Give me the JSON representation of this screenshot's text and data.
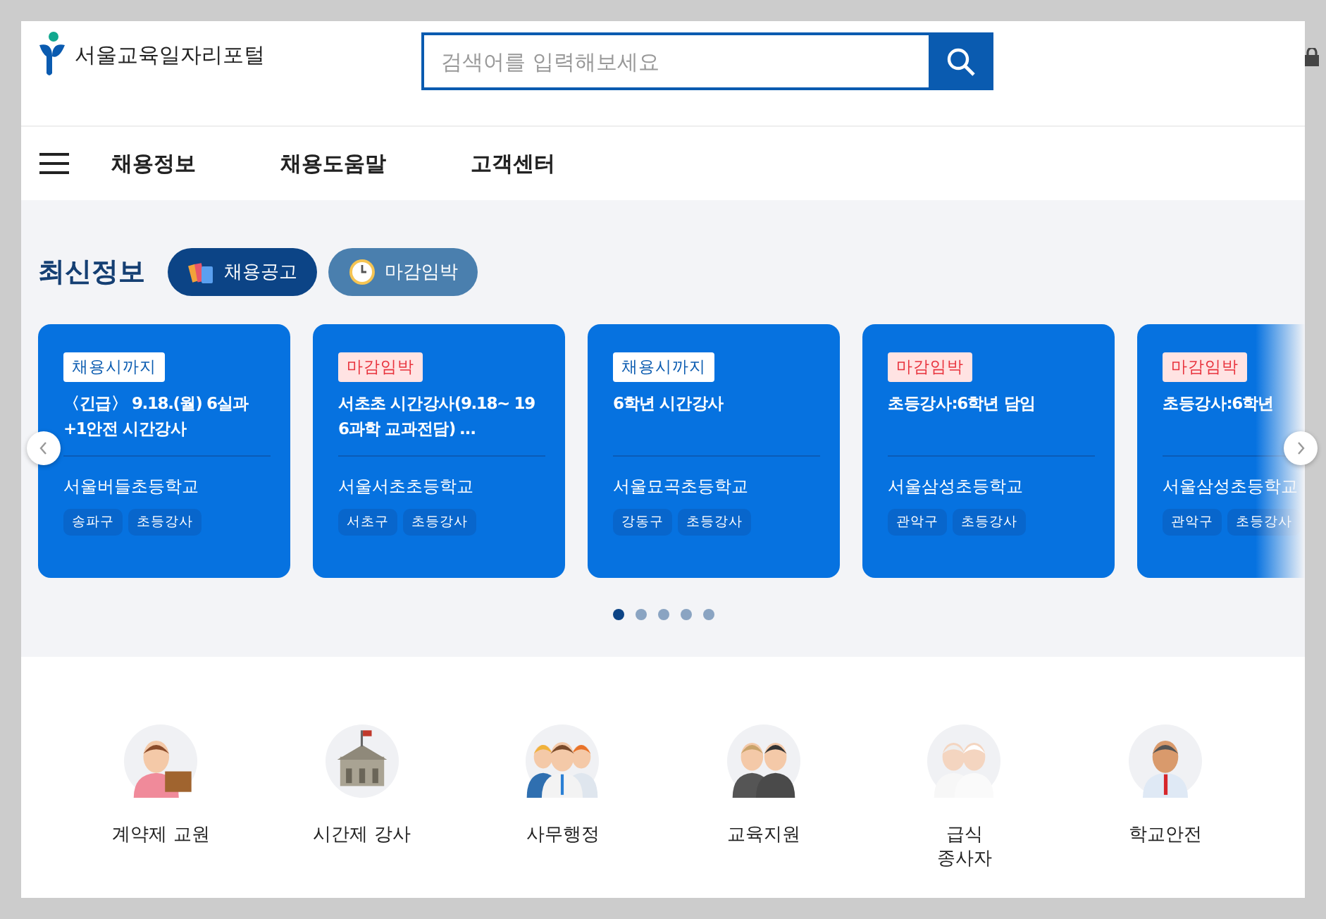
{
  "header": {
    "logo_text": "서울교육일자리포털",
    "search": {
      "placeholder": "검색어를 입력해보세요"
    }
  },
  "nav": {
    "items": [
      "채용정보",
      "채용도움말",
      "고객센터"
    ]
  },
  "latest": {
    "title": "최신정보",
    "tabs": [
      {
        "label": "채용공고",
        "selected": true
      },
      {
        "label": "마감임박",
        "selected": false
      }
    ],
    "cards": [
      {
        "badge": {
          "kind": "open",
          "label": "채용시까지"
        },
        "title": "〈긴급〉 9.18.(월) 6실과 +1안전 시간강사",
        "school": "서울버들초등학교",
        "tags": [
          "송파구",
          "초등강사"
        ]
      },
      {
        "badge": {
          "kind": "urgent",
          "label": "마감임박"
        },
        "title": "서초초 시간강사(9.18~ 19 6과학 교과전담) …",
        "school": "서울서초초등학교",
        "tags": [
          "서초구",
          "초등강사"
        ]
      },
      {
        "badge": {
          "kind": "open",
          "label": "채용시까지"
        },
        "title": "6학년 시간강사",
        "school": "서울묘곡초등학교",
        "tags": [
          "강동구",
          "초등강사"
        ]
      },
      {
        "badge": {
          "kind": "urgent",
          "label": "마감임박"
        },
        "title": "초등강사:6학년 담임",
        "school": "서울삼성초등학교",
        "tags": [
          "관악구",
          "초등강사"
        ]
      },
      {
        "badge": {
          "kind": "urgent",
          "label": "마감임박"
        },
        "title": "초등강사:6학년",
        "school": "서울삼성초등학교",
        "tags": [
          "관악구",
          "초등강사"
        ]
      }
    ],
    "dots": [
      {
        "selected": true
      },
      {
        "selected": false
      },
      {
        "selected": false
      },
      {
        "selected": false
      },
      {
        "selected": false
      }
    ]
  },
  "categories": [
    {
      "label": "계약제 교원"
    },
    {
      "label": "시간제 강사"
    },
    {
      "label": "사무행정"
    },
    {
      "label": "교육지원"
    },
    {
      "label": "급식\n종사자"
    },
    {
      "label": "학교안전"
    }
  ]
}
